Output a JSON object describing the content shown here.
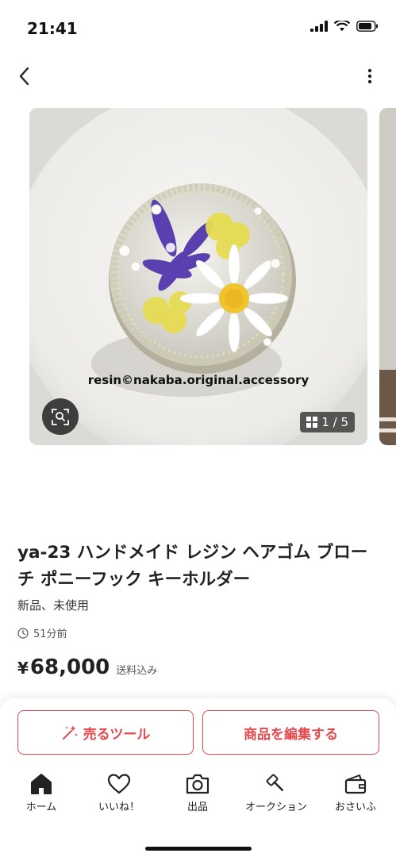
{
  "status_bar": {
    "time": "21:41"
  },
  "gallery": {
    "watermark": "resin©nakaba.original.accessory",
    "counter": "1 / 5"
  },
  "product": {
    "title": "ya-23 ハンドメイド レジン ヘアゴム ブローチ ポニーフック キーホルダー",
    "condition": "新品、未使用",
    "time_ago": "51分前",
    "price_symbol": "¥",
    "price": "68,000",
    "shipping": "送料込み"
  },
  "actions": {
    "sell_tool_label": "売るツール",
    "edit_label": "商品を編集する"
  },
  "tabs": [
    {
      "label": "ホーム",
      "icon": "home-icon"
    },
    {
      "label": "いいね！",
      "icon": "heart-icon"
    },
    {
      "label": "出品",
      "icon": "camera-icon"
    },
    {
      "label": "オークション",
      "icon": "gavel-icon"
    },
    {
      "label": "おさいふ",
      "icon": "wallet-icon"
    }
  ],
  "colors": {
    "accent": "#e5484d",
    "text": "#222222"
  }
}
